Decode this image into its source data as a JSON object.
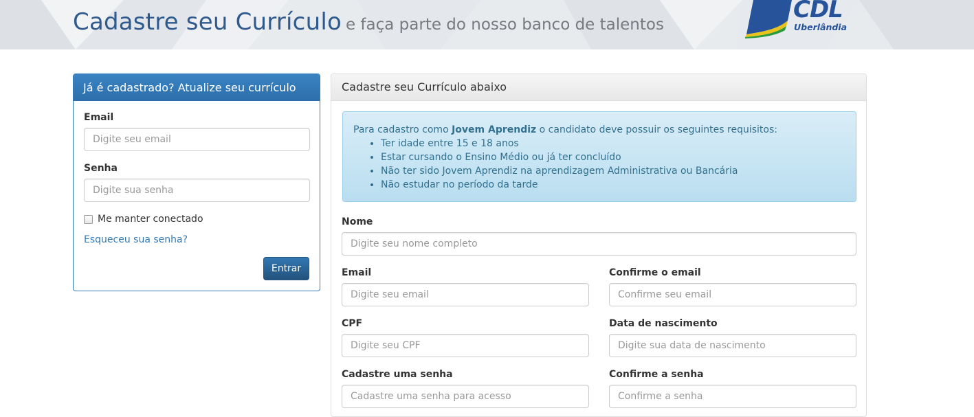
{
  "header": {
    "title": "Cadastre seu Currículo",
    "subtitle": "e faça parte do nosso banco de talentos",
    "logo_text": "CDL",
    "logo_city": "Uberlândia"
  },
  "login": {
    "heading": "Já é cadastrado? Atualize seu currículo",
    "email_label": "Email",
    "email_placeholder": "Digite seu email",
    "password_label": "Senha",
    "password_placeholder": "Digite sua senha",
    "remember_label": "Me manter conectado",
    "remember_checked": false,
    "forgot_link": "Esqueceu sua senha?",
    "submit_label": "Entrar"
  },
  "register": {
    "heading": "Cadastre seu Currículo abaixo",
    "notice": {
      "prefix": "Para cadastro como ",
      "highlight": "Jovem Aprendiz",
      "suffix": " o candidato deve possuir os seguintes requisitos:",
      "requirements": [
        "Ter idade entre 15 e 18 anos",
        "Estar cursando o Ensino Médio ou já ter concluído",
        "Não ter sido Jovem Aprendiz na aprendizagem Administrativa ou Bancária",
        "Não estudar no período da tarde"
      ]
    },
    "fields": {
      "name_label": "Nome",
      "name_placeholder": "Digite seu nome completo",
      "email_label": "Email",
      "email_placeholder": "Digite seu email",
      "email_confirm_label": "Confirme o email",
      "email_confirm_placeholder": "Confirme seu email",
      "cpf_label": "CPF",
      "cpf_placeholder": "Digite seu CPF",
      "birth_label": "Data de nascimento",
      "birth_placeholder": "Digite sua data de nascimento",
      "password_label": "Cadastre uma senha",
      "password_placeholder": "Cadastre uma senha para acesso",
      "password_confirm_label": "Confirme a senha",
      "password_confirm_placeholder": "Confirme a senha"
    }
  },
  "colors": {
    "brand_blue": "#2e5a8e",
    "primary": "#337ab7",
    "alert_bg": "#d9edf7",
    "alert_text": "#31708f"
  }
}
